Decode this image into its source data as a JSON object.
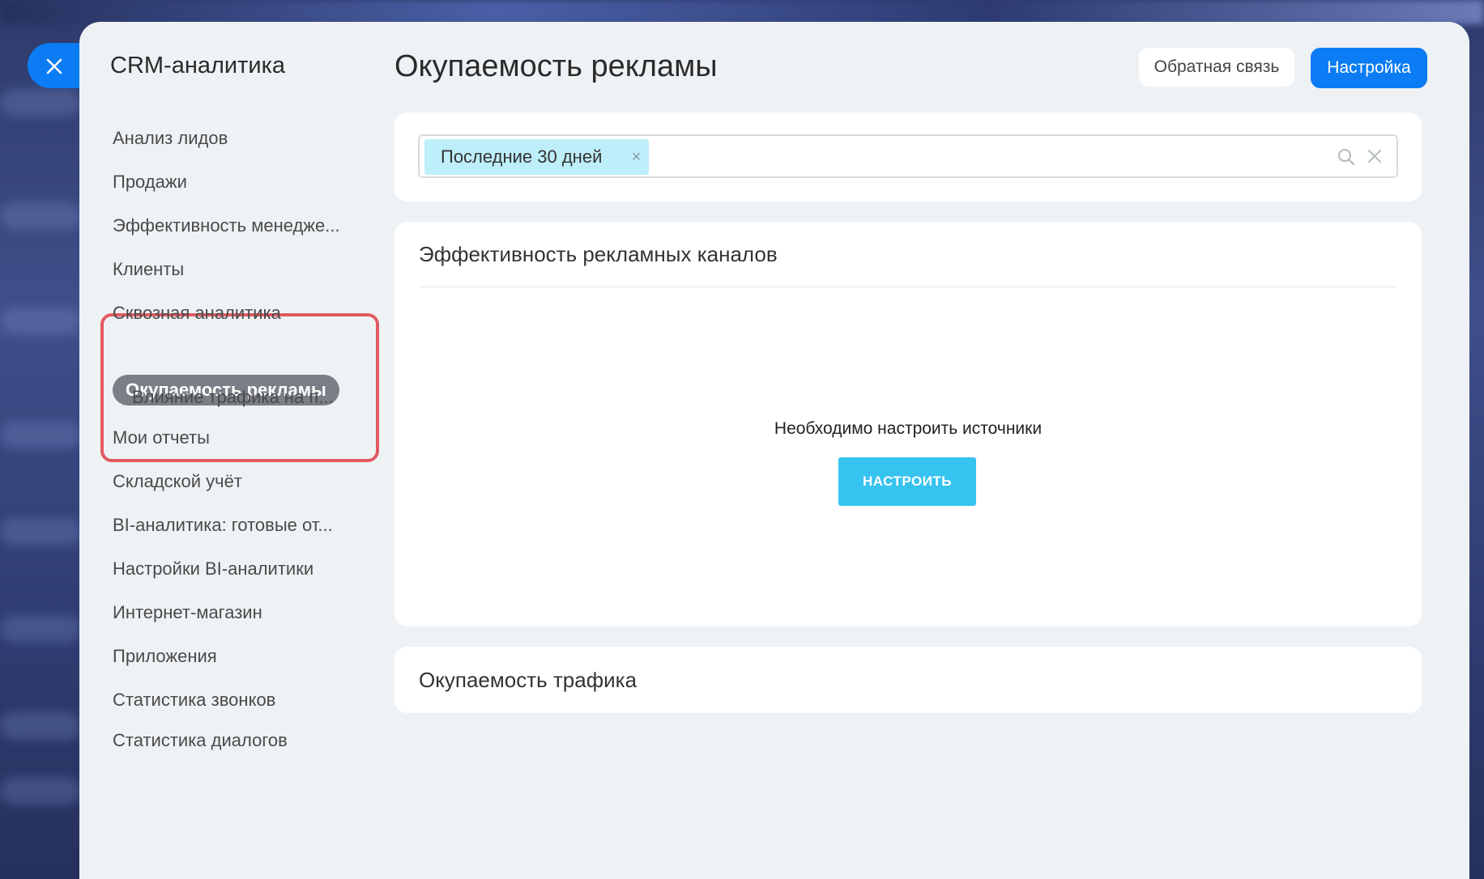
{
  "sidebar": {
    "title": "CRM-аналитика",
    "items": [
      {
        "label": "Анализ лидов"
      },
      {
        "label": "Продажи"
      },
      {
        "label": "Эффективность менедже..."
      },
      {
        "label": "Клиенты"
      },
      {
        "label": "Сквозная аналитика"
      },
      {
        "label": "Окупаемость рекламы",
        "active": true
      },
      {
        "label": "Влияние трафика на п..."
      },
      {
        "label": "Мои отчеты"
      },
      {
        "label": "Складской учёт"
      },
      {
        "label": "BI-аналитика: готовые от..."
      },
      {
        "label": "Настройки BI-аналитики"
      },
      {
        "label": "Интернет-магазин"
      },
      {
        "label": "Приложения"
      },
      {
        "label": "Статистика звонков"
      },
      {
        "label": "Статистика диалогов"
      }
    ]
  },
  "header": {
    "title": "Окупаемость рекламы",
    "feedback_label": "Обратная связь",
    "settings_label": "Настройка"
  },
  "filter": {
    "chip_label": "Последние 30 дней",
    "chip_remove": "×"
  },
  "channels": {
    "title": "Эффективность рекламных каналов",
    "empty_message": "Необходимо настроить источники",
    "configure_label": "НАСТРОИТЬ"
  },
  "traffic": {
    "title": "Окупаемость трафика"
  },
  "colors": {
    "accent": "#0b7cf3",
    "configure_button": "#36c3ef",
    "chip": "#bdeef9",
    "highlight": "#e25a61",
    "active_pill": "#7a7f87"
  },
  "icons": {
    "close": "close-icon",
    "search": "search-icon",
    "clear": "clear-icon"
  }
}
